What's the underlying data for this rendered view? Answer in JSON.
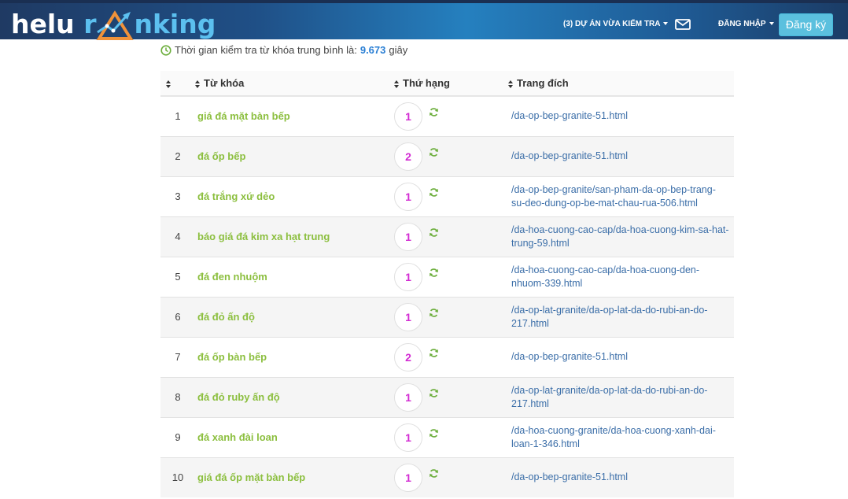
{
  "header": {
    "logo_part1": "helu",
    "logo_part2": "r",
    "logo_part3": "nking",
    "projects_label": "(3) DỰ ÁN VỪA KIỂM TRA",
    "login_label": "ĐĂNG NHẬP",
    "register_label": "Đăng ký",
    "mail_icon": "envelope-icon"
  },
  "summary": {
    "label": "Thời gian kiểm tra từ khóa trung bình là:",
    "value": "9.673",
    "unit": "giây"
  },
  "table": {
    "headers": {
      "keyword": "Từ khóa",
      "rank": "Thứ hạng",
      "url": "Trang đích"
    },
    "rows": [
      {
        "idx": "1",
        "keyword": "giá đá mặt bàn bếp",
        "rank": "1",
        "url": "/da-op-bep-granite-51.html"
      },
      {
        "idx": "2",
        "keyword": "đá ốp bếp",
        "rank": "2",
        "url": "/da-op-bep-granite-51.html"
      },
      {
        "idx": "3",
        "keyword": "đá trắng xứ dẻo",
        "rank": "1",
        "url": "/da-op-bep-granite/san-pham-da-op-bep-trang-su-deo-dung-op-be-mat-chau-rua-506.html"
      },
      {
        "idx": "4",
        "keyword": "báo giá đá kim xa hạt trung",
        "rank": "1",
        "url": "/da-hoa-cuong-cao-cap/da-hoa-cuong-kim-sa-hat-trung-59.html"
      },
      {
        "idx": "5",
        "keyword": "đá đen nhuộm",
        "rank": "1",
        "url": "/da-hoa-cuong-cao-cap/da-hoa-cuong-den-nhuom-339.html"
      },
      {
        "idx": "6",
        "keyword": "đá đỏ ấn độ",
        "rank": "1",
        "url": "/da-op-lat-granite/da-op-lat-da-do-rubi-an-do-217.html"
      },
      {
        "idx": "7",
        "keyword": "đá ốp bàn bếp",
        "rank": "2",
        "url": "/da-op-bep-granite-51.html"
      },
      {
        "idx": "8",
        "keyword": "đá đỏ ruby ấn độ",
        "rank": "1",
        "url": "/da-op-lat-granite/da-op-lat-da-do-rubi-an-do-217.html"
      },
      {
        "idx": "9",
        "keyword": "đá xanh đài loan",
        "rank": "1",
        "url": "/da-hoa-cuong-granite/da-hoa-cuong-xanh-dai-loan-1-346.html"
      },
      {
        "idx": "10",
        "keyword": "giá đá ốp mặt bàn bếp",
        "rank": "1",
        "url": "/da-op-bep-granite-51.html"
      }
    ]
  },
  "colors": {
    "keyword": "#8cbf3f",
    "rank": "#d32bd3",
    "url": "#3b6ea8",
    "register_button": "#5bc0de",
    "avg_value": "#2a7fd4"
  }
}
